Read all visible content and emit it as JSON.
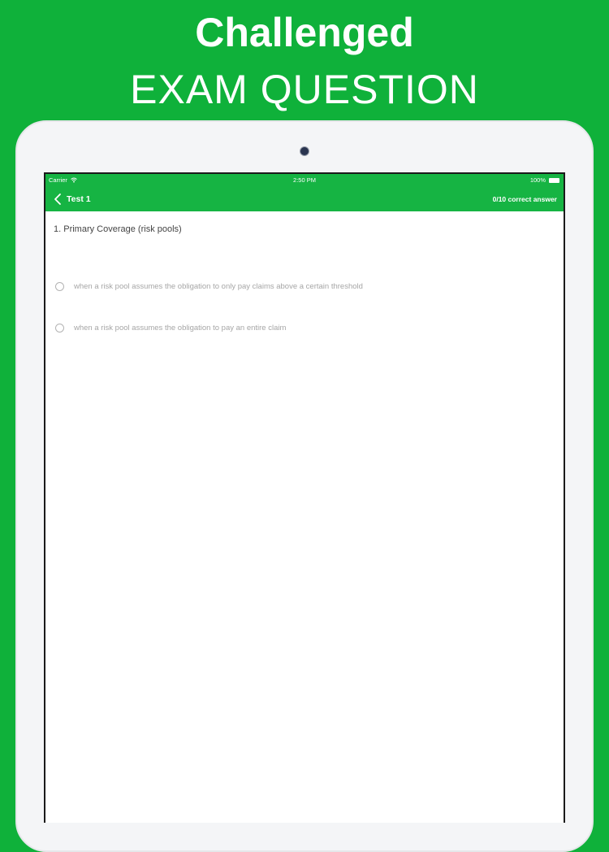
{
  "promo": {
    "line1": "Challenged",
    "line2": "EXAM QUESTION"
  },
  "status_bar": {
    "carrier": "Carrier",
    "time": "2:50 PM",
    "battery": "100%"
  },
  "nav": {
    "title": "Test 1",
    "score": "0/10 correct answer"
  },
  "question": {
    "text": "1. Primary Coverage (risk pools)",
    "options": [
      {
        "label": "when a risk pool assumes the obligation to only pay claims above a certain threshold",
        "selected": false
      },
      {
        "label": "when a risk pool assumes the obligation to pay an entire claim",
        "selected": false
      }
    ]
  },
  "colors": {
    "background": "#0fb13a",
    "nav": "#16b443"
  },
  "icons": [
    "wifi-icon",
    "battery-icon",
    "back-chevron-icon",
    "radio-icon",
    "camera-icon"
  ]
}
